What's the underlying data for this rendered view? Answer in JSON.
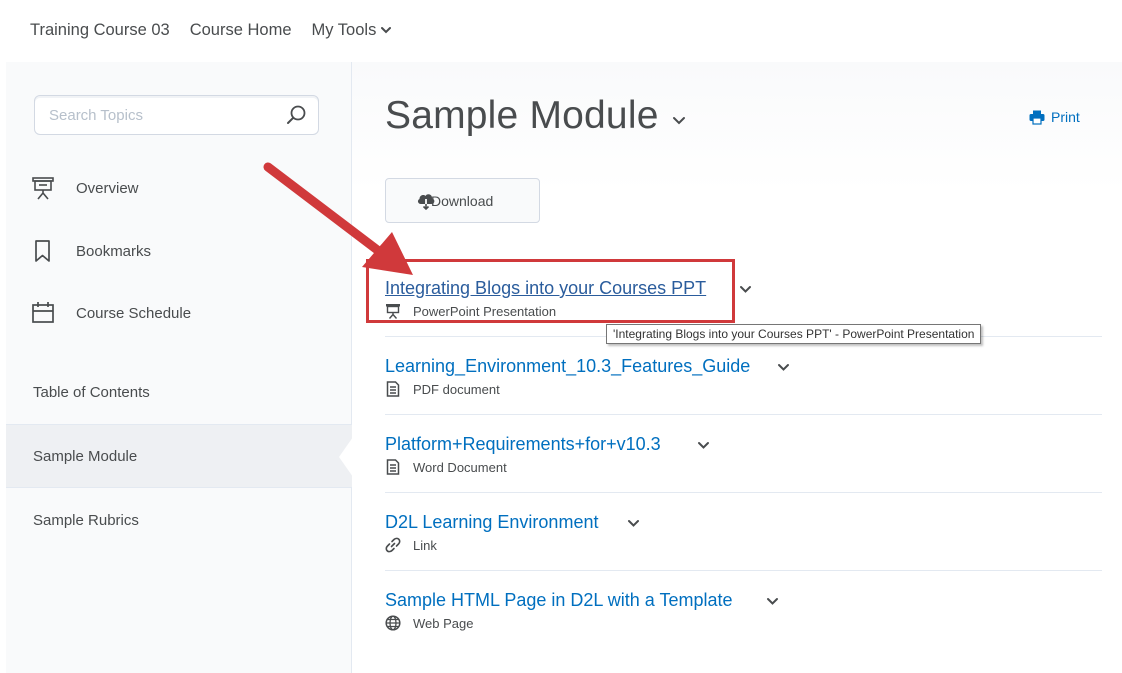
{
  "topnav": {
    "course": "Training Course 03",
    "home": "Course Home",
    "tools": "My Tools"
  },
  "sidebar": {
    "search_placeholder": "Search Topics",
    "items": [
      {
        "label": "Overview",
        "icon": "presentation-icon"
      },
      {
        "label": "Bookmarks",
        "icon": "bookmark-icon"
      },
      {
        "label": "Course Schedule",
        "icon": "calendar-icon"
      }
    ],
    "toc": [
      {
        "label": "Table of Contents"
      },
      {
        "label": "Sample Module",
        "active": true
      },
      {
        "label": "Sample Rubrics"
      }
    ]
  },
  "main": {
    "title": "Sample Module",
    "print_label": "Print",
    "download_label": "Download",
    "topics": [
      {
        "title": "Integrating Blogs into your Courses PPT",
        "type": "PowerPoint Presentation",
        "icon": "presentation-icon"
      },
      {
        "title": "Learning_Environment_10.3_Features_Guide",
        "type": "PDF document",
        "icon": "document-icon"
      },
      {
        "title": "Platform+Requirements+for+v10.3",
        "type": "Word Document",
        "icon": "document-icon"
      },
      {
        "title": "D2L Learning Environment",
        "type": "Link",
        "icon": "link-icon"
      },
      {
        "title": "Sample HTML Page in D2L with a Template",
        "type": "Web Page",
        "icon": "globe-icon"
      }
    ],
    "tooltip": "'Integrating Blogs into your Courses PPT' - PowerPoint Presentation"
  },
  "colors": {
    "link": "#006fbf",
    "text": "#494c4e",
    "annotation": "#d0393b"
  }
}
